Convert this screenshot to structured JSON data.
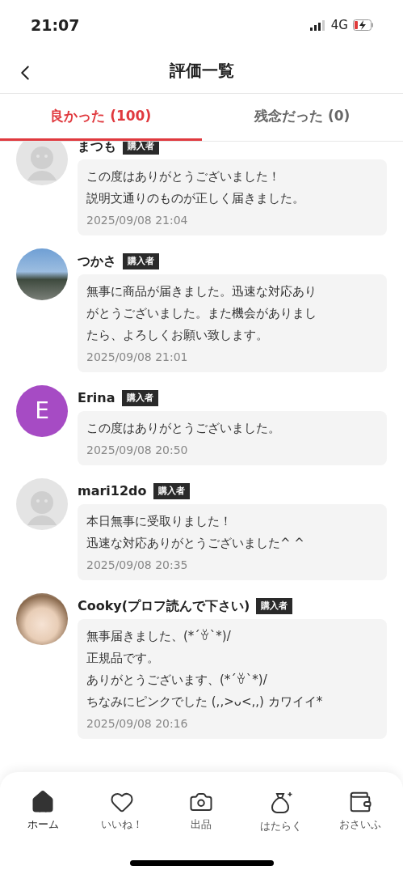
{
  "status_bar": {
    "time": "21:07",
    "network": "4G"
  },
  "header": {
    "title": "評価一覧"
  },
  "tabs": [
    {
      "label": "良かった (100)",
      "selected": true
    },
    {
      "label": "残念だった (0)",
      "selected": false
    }
  ],
  "reviews": [
    {
      "name": "まつも",
      "badge": "購入者",
      "avatar": {
        "kind": "placeholder"
      },
      "lines": [
        "この度はありがとうございました！",
        "説明文通りのものが正しく届きました。"
      ],
      "date": "2025/09/08 21:04"
    },
    {
      "name": "つかさ",
      "badge": "購入者",
      "avatar": {
        "kind": "photo"
      },
      "lines": [
        "無事に商品が届きました。迅速な対応あり",
        "がとうございました。また機会がありまし",
        "たら、よろしくお願い致します。"
      ],
      "date": "2025/09/08 21:01"
    },
    {
      "name": "Erina",
      "badge": "購入者",
      "avatar": {
        "kind": "letter",
        "letter": "E",
        "color": "#a64bc4"
      },
      "lines": [
        "この度はありがとうございました。"
      ],
      "date": "2025/09/08 20:50"
    },
    {
      "name": "mari12do",
      "badge": "購入者",
      "avatar": {
        "kind": "placeholder"
      },
      "lines": [
        "本日無事に受取りました！",
        "迅速な対応ありがとうございました^ ^"
      ],
      "date": "2025/09/08 20:35"
    },
    {
      "name": "Cooky(プロフ読んで下さい)",
      "badge": "購入者",
      "avatar": {
        "kind": "illustration"
      },
      "lines": [
        "無事届きました、(*´ꈊ`*)/",
        "正規品です。",
        "ありがとうございます、(*´ꈊ`*)/",
        "ちなみにピンクでした (,,>ᴗ<,,) カワイイ*"
      ],
      "date": "2025/09/08 20:16"
    }
  ],
  "nav": [
    {
      "label": "ホーム",
      "selected": true
    },
    {
      "label": "いいね！",
      "selected": false
    },
    {
      "label": "出品",
      "selected": false
    },
    {
      "label": "はたらく",
      "selected": false
    },
    {
      "label": "おさいふ",
      "selected": false
    }
  ]
}
